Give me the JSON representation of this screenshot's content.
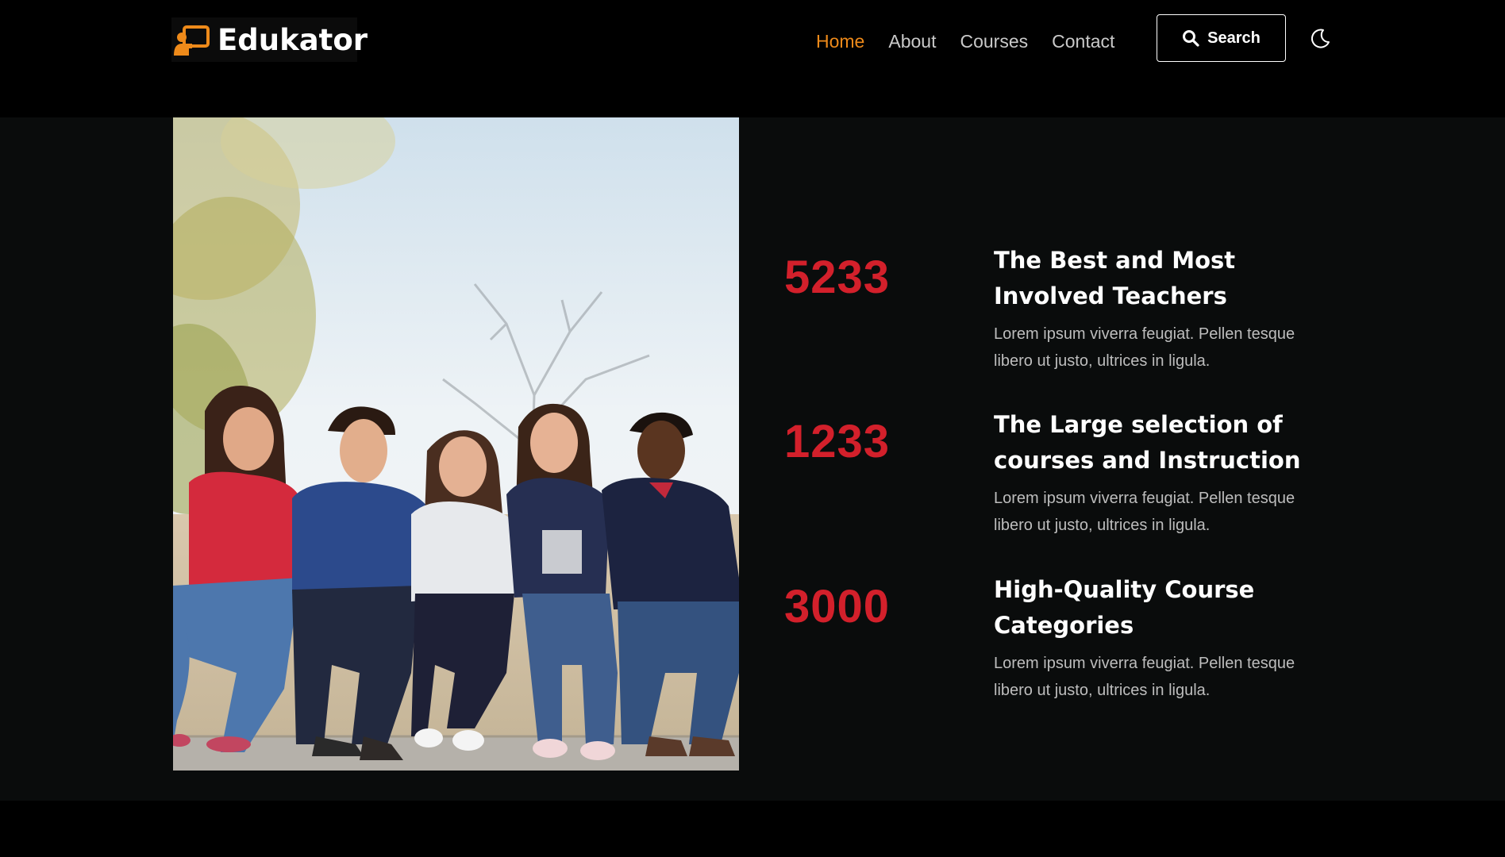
{
  "brand": {
    "name": "Edukator",
    "icon": "chalkboard-teacher-icon",
    "accent_color": "#ee8a1a"
  },
  "nav": {
    "items": [
      {
        "label": "Home",
        "active": true
      },
      {
        "label": "About",
        "active": false
      },
      {
        "label": "Courses",
        "active": false
      },
      {
        "label": "Contact",
        "active": false
      }
    ]
  },
  "search": {
    "label": "Search",
    "icon": "search-icon"
  },
  "theme_toggle": {
    "icon": "moon-icon"
  },
  "stats": [
    {
      "number": "5233",
      "title": "The Best and Most Involved Teachers",
      "description": "Lorem ipsum viverra feugiat. Pellen tesque libero ut justo, ultrices in ligula."
    },
    {
      "number": "1233",
      "title": "The Large selection of courses and Instruction",
      "description": "Lorem ipsum viverra feugiat. Pellen tesque libero ut justo, ultrices in ligula."
    },
    {
      "number": "3000",
      "title": "High-Quality Course Categories",
      "description": "Lorem ipsum viverra feugiat. Pellen tesque libero ut justo, ultrices in ligula."
    }
  ],
  "colors": {
    "stat_number": "#d3202b",
    "background": "#0a0c0c"
  }
}
